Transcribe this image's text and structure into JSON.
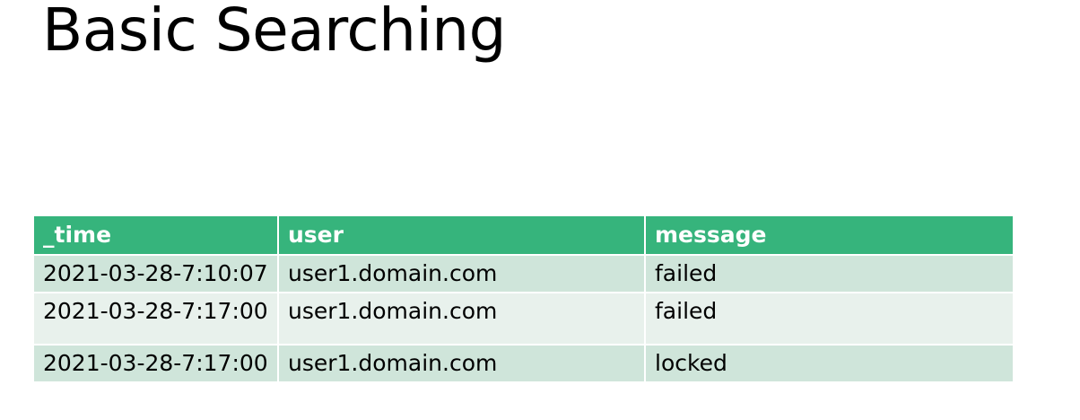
{
  "slide": {
    "title": "Basic Searching"
  },
  "table": {
    "headers": [
      "_time",
      "user",
      "message"
    ],
    "rows": [
      [
        "2021-03-28-7:10:07",
        "user1.domain.com",
        "failed"
      ],
      [
        "2021-03-28-7:17:00",
        "user1.domain.com",
        "failed"
      ],
      [
        "2021-03-28-7:17:00",
        "user1.domain.com",
        "locked"
      ]
    ]
  },
  "colors": {
    "header_background": "#36b47c",
    "header_text": "#ffffff",
    "row_dark": "#cfe5da",
    "row_light": "#e8f1ec"
  }
}
